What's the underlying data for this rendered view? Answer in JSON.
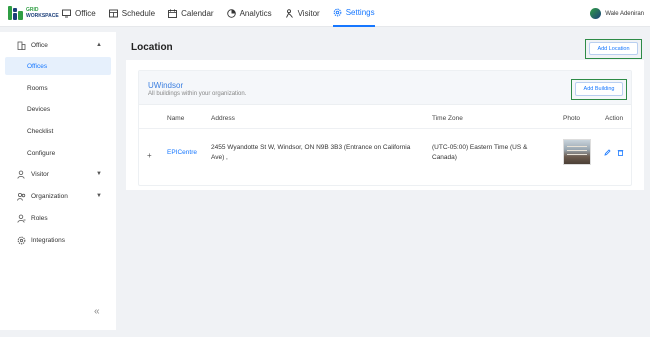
{
  "brand": {
    "line1": "GRID",
    "line2": "WORKSPACE"
  },
  "nav": {
    "items": [
      {
        "label": "Office",
        "icon": "monitor-icon"
      },
      {
        "label": "Schedule",
        "icon": "calendar-table-icon"
      },
      {
        "label": "Calendar",
        "icon": "calendar-icon"
      },
      {
        "label": "Analytics",
        "icon": "pie-chart-icon"
      },
      {
        "label": "Visitor",
        "icon": "visitor-icon"
      },
      {
        "label": "Settings",
        "icon": "gear-icon",
        "active": true
      }
    ]
  },
  "user": {
    "name": "Wale Adeniran"
  },
  "sidebar": {
    "office": "Office",
    "sub": [
      "Offices",
      "Rooms",
      "Devices",
      "Checklist",
      "Configure"
    ],
    "visitor": "Visitor",
    "organization": "Organization",
    "roles": "Roles",
    "integrations": "Integrations",
    "collapse": "«"
  },
  "page": {
    "title": "Location",
    "add_location": "Add Location"
  },
  "card": {
    "title": "UWindsor",
    "subtitle": "All buildings within your organization.",
    "add_building": "Add Building"
  },
  "table": {
    "headers": [
      "Name",
      "Address",
      "Time Zone",
      "Photo",
      "Action"
    ],
    "rows": [
      {
        "expand": "+",
        "name": "EPICentre",
        "address_line1": "2455 Wyandotte St W, Windsor, ON N9B 3B3 (Entrance on California",
        "address_line2": "Ave) ,",
        "tz_line1": "(UTC-05:00) Eastern Time (US &",
        "tz_line2": "Canada)"
      }
    ]
  },
  "colors": {
    "accent": "#1677ff",
    "highlight": "#2e8b47",
    "brand_green": "#2f9e44",
    "brand_navy": "#1c3f7a"
  }
}
